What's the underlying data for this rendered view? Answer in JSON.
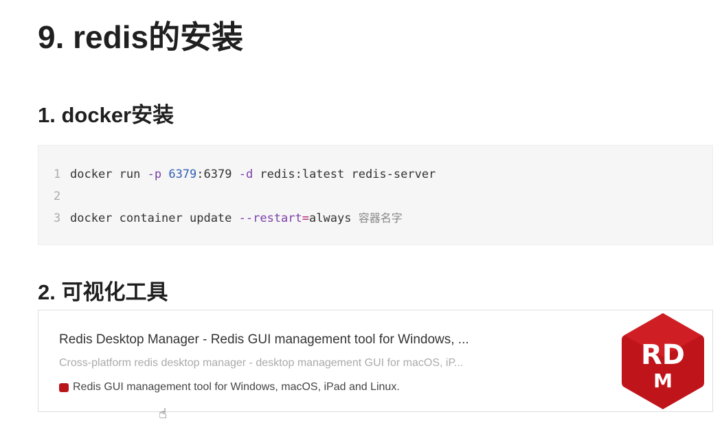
{
  "title": "9. redis的安装",
  "sections": [
    {
      "heading": "1. docker安装"
    },
    {
      "heading": "2. 可视化工具"
    }
  ],
  "code": {
    "lines": [
      {
        "n": "1",
        "parts": [
          "docker run ",
          "-p",
          " ",
          "6379",
          ":6379 ",
          "-d",
          " redis:latest redis-server"
        ]
      },
      {
        "n": "2"
      },
      {
        "n": "3",
        "parts": [
          "docker container update ",
          "--restart",
          "=",
          "always",
          " ",
          "容器名字"
        ]
      }
    ]
  },
  "link_card": {
    "title": "Redis Desktop Manager - Redis GUI management tool for Windows, ...",
    "description": "Cross-platform redis desktop manager - desktop management GUI for macOS, iP...",
    "site": "Redis GUI management tool for Windows, macOS, iPad and Linux.",
    "logo_text": "RDM",
    "logo_color": "#c0141b"
  }
}
